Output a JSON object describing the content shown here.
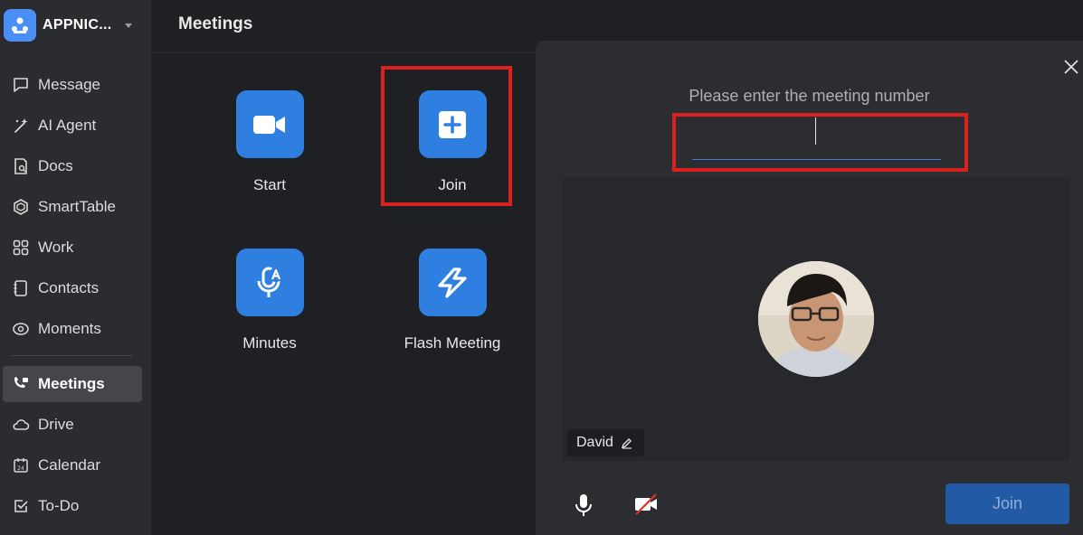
{
  "org": {
    "name": "APPNIC..."
  },
  "sidebar": {
    "items": [
      {
        "label": "Message",
        "icon": "message-icon"
      },
      {
        "label": "AI Agent",
        "icon": "ai-sparkle-icon"
      },
      {
        "label": "Docs",
        "icon": "docs-icon"
      },
      {
        "label": "SmartTable",
        "icon": "smarttable-icon"
      },
      {
        "label": "Work",
        "icon": "work-grid-icon"
      },
      {
        "label": "Contacts",
        "icon": "contacts-icon"
      },
      {
        "label": "Moments",
        "icon": "moments-icon"
      },
      {
        "label": "Meetings",
        "icon": "meetings-icon",
        "active": true
      },
      {
        "label": "Drive",
        "icon": "drive-cloud-icon"
      },
      {
        "label": "Calendar",
        "icon": "calendar-icon"
      },
      {
        "label": "To-Do",
        "icon": "todo-check-icon"
      }
    ]
  },
  "main": {
    "title": "Meetings",
    "tiles": [
      {
        "label": "Start",
        "icon": "video-camera-icon"
      },
      {
        "label": "Join",
        "icon": "plus-square-icon"
      },
      {
        "label": "Minutes",
        "icon": "microphone-ai-icon"
      },
      {
        "label": "Flash Meeting",
        "icon": "flash-icon"
      }
    ]
  },
  "dialog": {
    "prompt": "Please enter the meeting number",
    "meeting_number_value": "",
    "user_name": "David",
    "join_label": "Join"
  },
  "colors": {
    "accent": "#2f7fe0",
    "highlight": "#d9221f",
    "join_button": "#235aa6"
  }
}
